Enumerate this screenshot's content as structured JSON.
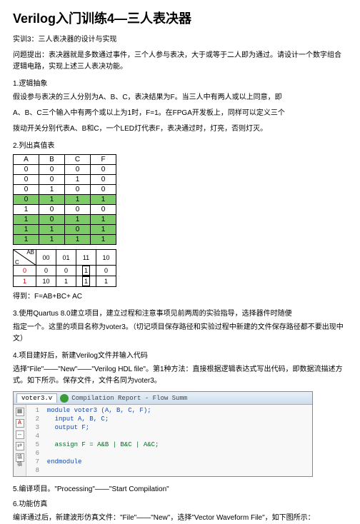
{
  "title": "Verilog入门训练4—三人表决器",
  "p1": "实训3：三人表决器的设计与实现",
  "p2": "问题提出：表决器就是多数通过事件，三个人参与表决，大于或等于二人即为通过。请设计一个数字组合逻辑电路，实现上述三人表决功能。",
  "s1": "1.逻辑抽象",
  "p3": "假设参与表决的三人分别为A、B、C，表决结果为F。当三人中有两人或以上同意，即",
  "p4": "A、B、C三个输入中有两个或以上为1时，F=1。在FPGA开发板上，同样可以定义三个",
  "p5": "拨动开关分别代表A、B和C，一个LED灯代表F，表决通过时，灯亮，否则灯灭。",
  "s2": "2.列出真值表",
  "truth": {
    "head": [
      "A",
      "B",
      "C",
      "F"
    ],
    "rows": [
      [
        "0",
        "0",
        "0",
        "0"
      ],
      [
        "0",
        "0",
        "1",
        "0"
      ],
      [
        "0",
        "1",
        "0",
        "0"
      ],
      [
        "0",
        "1",
        "1",
        "1"
      ],
      [
        "1",
        "0",
        "0",
        "0"
      ],
      [
        "1",
        "0",
        "1",
        "1"
      ],
      [
        "1",
        "1",
        "0",
        "1"
      ],
      [
        "1",
        "1",
        "1",
        "1"
      ]
    ],
    "hl": [
      3,
      5,
      6,
      7
    ]
  },
  "kmap": {
    "ab": "AB",
    "c": "C",
    "cols": [
      "00",
      "01",
      "11",
      "10"
    ],
    "r0": [
      "0",
      "0",
      "0",
      "1",
      "0"
    ],
    "r1": [
      "1",
      "10",
      "1",
      "1",
      "1"
    ]
  },
  "expr": "得到：F=AB+BC+ AC",
  "s3": "3.使用Quartus 8.0建立项目，建立过程和注意事项见前两周的实验指导，选择器件时随便",
  "p6": "指定一个。这里的项目名称为voter3。（切记项目保存路径和实验过程中新建的文件保存路径都不要出现中文）",
  "s4": "4.项目建好后，新建Verilog文件并输入代码",
  "p7": "选择\"File\"——\"New\"——\"Verilog HDL file\"。第1种方法：直接根据逻辑表达式写出代码，即数据流描述方式。如下所示。保存文件，文件名同为voter3。",
  "code": {
    "tab1": "voter3.v",
    "tab2_icon": "✓",
    "tab2": "Compilation Report - Flow Summ",
    "lines": [
      {
        "n": "1",
        "t": "module voter3 (A, B, C, F);",
        "cls": "kw"
      },
      {
        "n": "2",
        "t": "  input A, B, C;",
        "cls": "kw"
      },
      {
        "n": "3",
        "t": "  output F;",
        "cls": "kw"
      },
      {
        "n": "4",
        "t": "",
        "cls": ""
      },
      {
        "n": "5",
        "t": "  assign F = A&B | B&C | A&C;",
        "cls": "sig"
      },
      {
        "n": "6",
        "t": "",
        "cls": ""
      },
      {
        "n": "7",
        "t": "endmodule",
        "cls": "kw"
      },
      {
        "n": "8",
        "t": "",
        "cls": ""
      }
    ]
  },
  "s5": "5.编译项目。\"Processing\"——\"Start Compilation\"",
  "s6": "6.功能仿真",
  "p8": "编译通过后，新建波形仿真文件：\"File\"——\"New\"，选择\"Vector Waveform File\"，如下图所示："
}
